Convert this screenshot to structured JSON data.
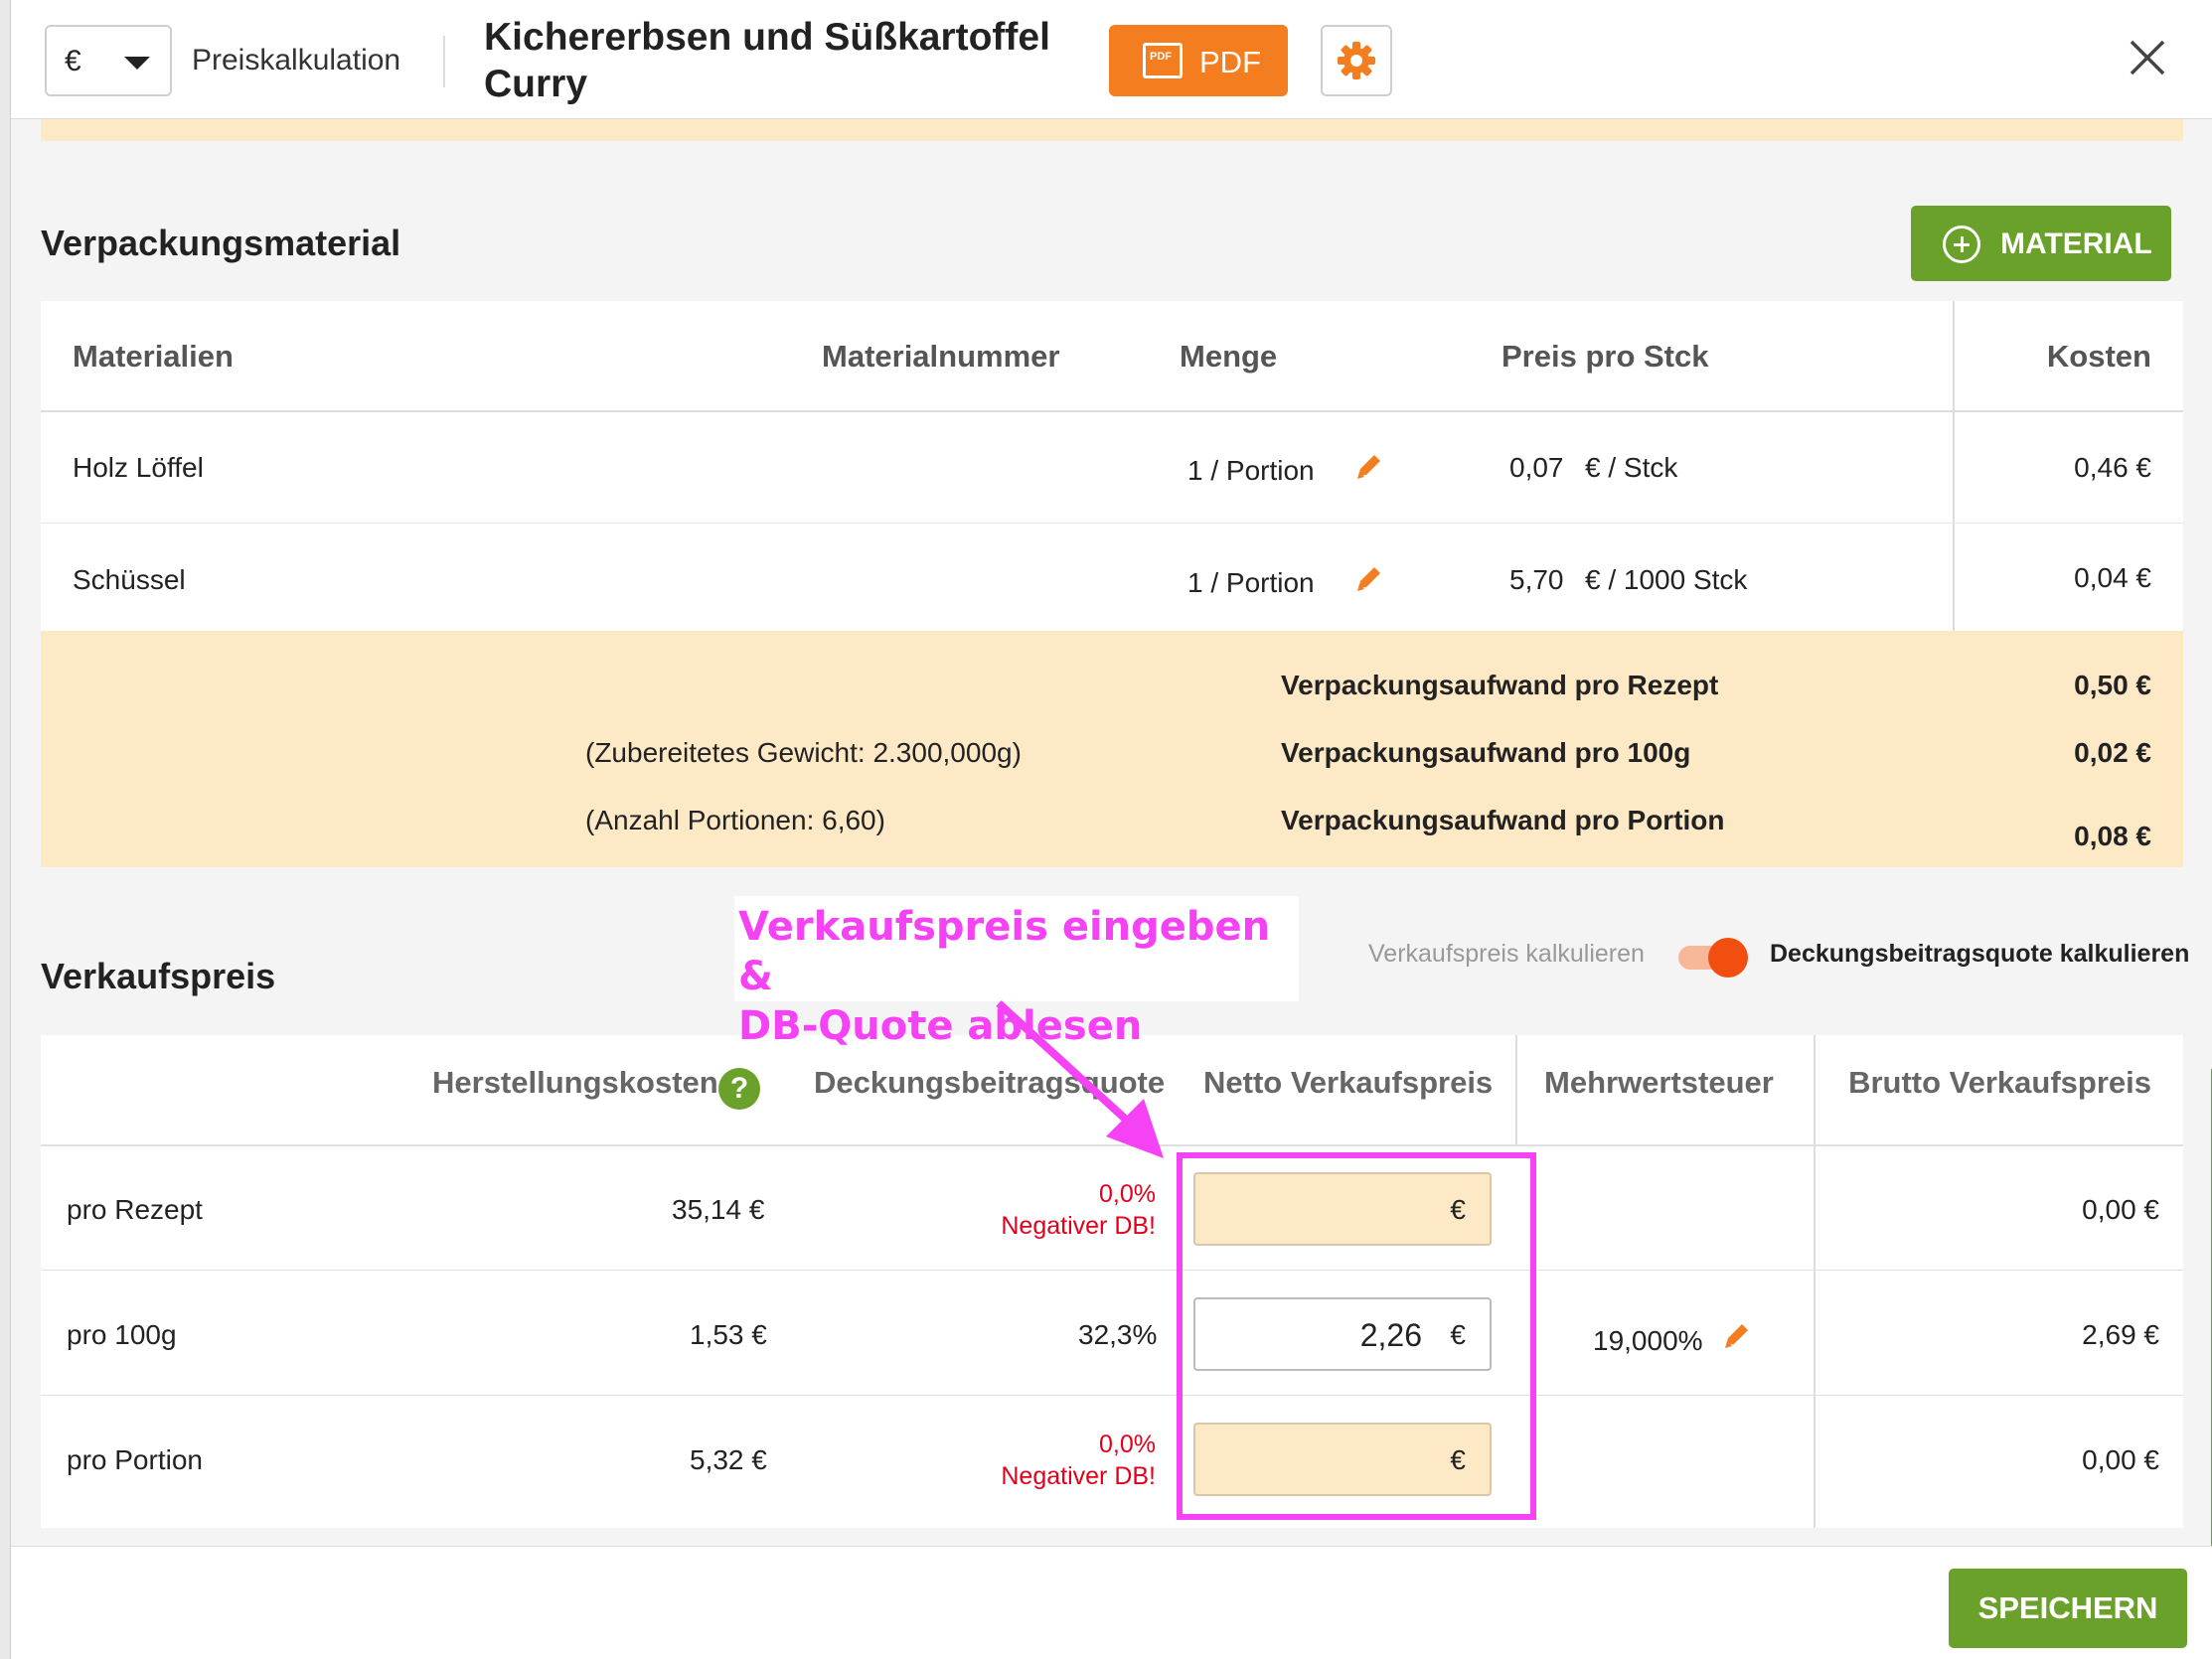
{
  "header": {
    "currency": "€",
    "section_label": "Preiskalkulation",
    "title": "Kichererbsen und Süßkartoffel Curry",
    "pdf_label": "PDF"
  },
  "packaging": {
    "title": "Verpackungsmaterial",
    "add_button": "MATERIAL",
    "columns": [
      "Materialien",
      "Materialnummer",
      "Menge",
      "Preis pro Stck",
      "Kosten"
    ],
    "rows": [
      {
        "name": "Holz Löffel",
        "number": "",
        "qty": "1 / Portion",
        "price": "0,07",
        "unit": "€ / Stck",
        "cost": "0,46 €"
      },
      {
        "name": "Schüssel",
        "number": "",
        "qty": "1 / Portion",
        "price": "5,70",
        "unit": "€ / 1000 Stck",
        "cost": "0,04 €"
      }
    ],
    "notes": [
      "(Zubereitetes Gewicht: 2.300,000g)",
      "(Anzahl Portionen: 6,60)"
    ],
    "totals": [
      {
        "label": "Verpackungsaufwand pro Rezept",
        "value": "0,50 €"
      },
      {
        "label": "Verpackungsaufwand pro 100g",
        "value": "0,02 €"
      },
      {
        "label": "Verpackungsaufwand pro Portion",
        "value": "0,08 €"
      }
    ]
  },
  "annotation": {
    "line1": "Verkaufspreis eingeben &",
    "line2": "DB-Quote ablesen",
    "color": "#f442f4"
  },
  "sales": {
    "title": "Verkaufspreis",
    "toggle_left": "Verkaufspreis kalkulieren",
    "toggle_right": "Deckungsbeitragsquote kalkulieren",
    "toggle_on": true,
    "columns": [
      "Herstellungskosten",
      "Deckungsbeitragsquote",
      "Netto Verkaufspreis",
      "Mehrwertsteuer",
      "Brutto Verkaufspreis"
    ],
    "help_glyph": "?",
    "currency": "€",
    "vat": "19,000%",
    "rows": [
      {
        "label": "pro Rezept",
        "cost": "35,14 €",
        "db_value": "0,0%",
        "db_warning": "Negativer DB!",
        "net": "",
        "gross": "0,00 €"
      },
      {
        "label": "pro 100g",
        "cost": "1,53 €",
        "db_value": "32,3%",
        "db_warning": "",
        "net": "2,26",
        "gross": "2,69 €"
      },
      {
        "label": "pro Portion",
        "cost": "5,32 €",
        "db_value": "0,0%",
        "db_warning": "Negativer DB!",
        "net": "",
        "gross": "0,00 €"
      }
    ]
  },
  "footer": {
    "save_label": "SPEICHERN"
  },
  "colors": {
    "orange": "#f47e1f",
    "green": "#6aa12a",
    "highlight": "#fde9c6",
    "negative": "#e3001b"
  }
}
